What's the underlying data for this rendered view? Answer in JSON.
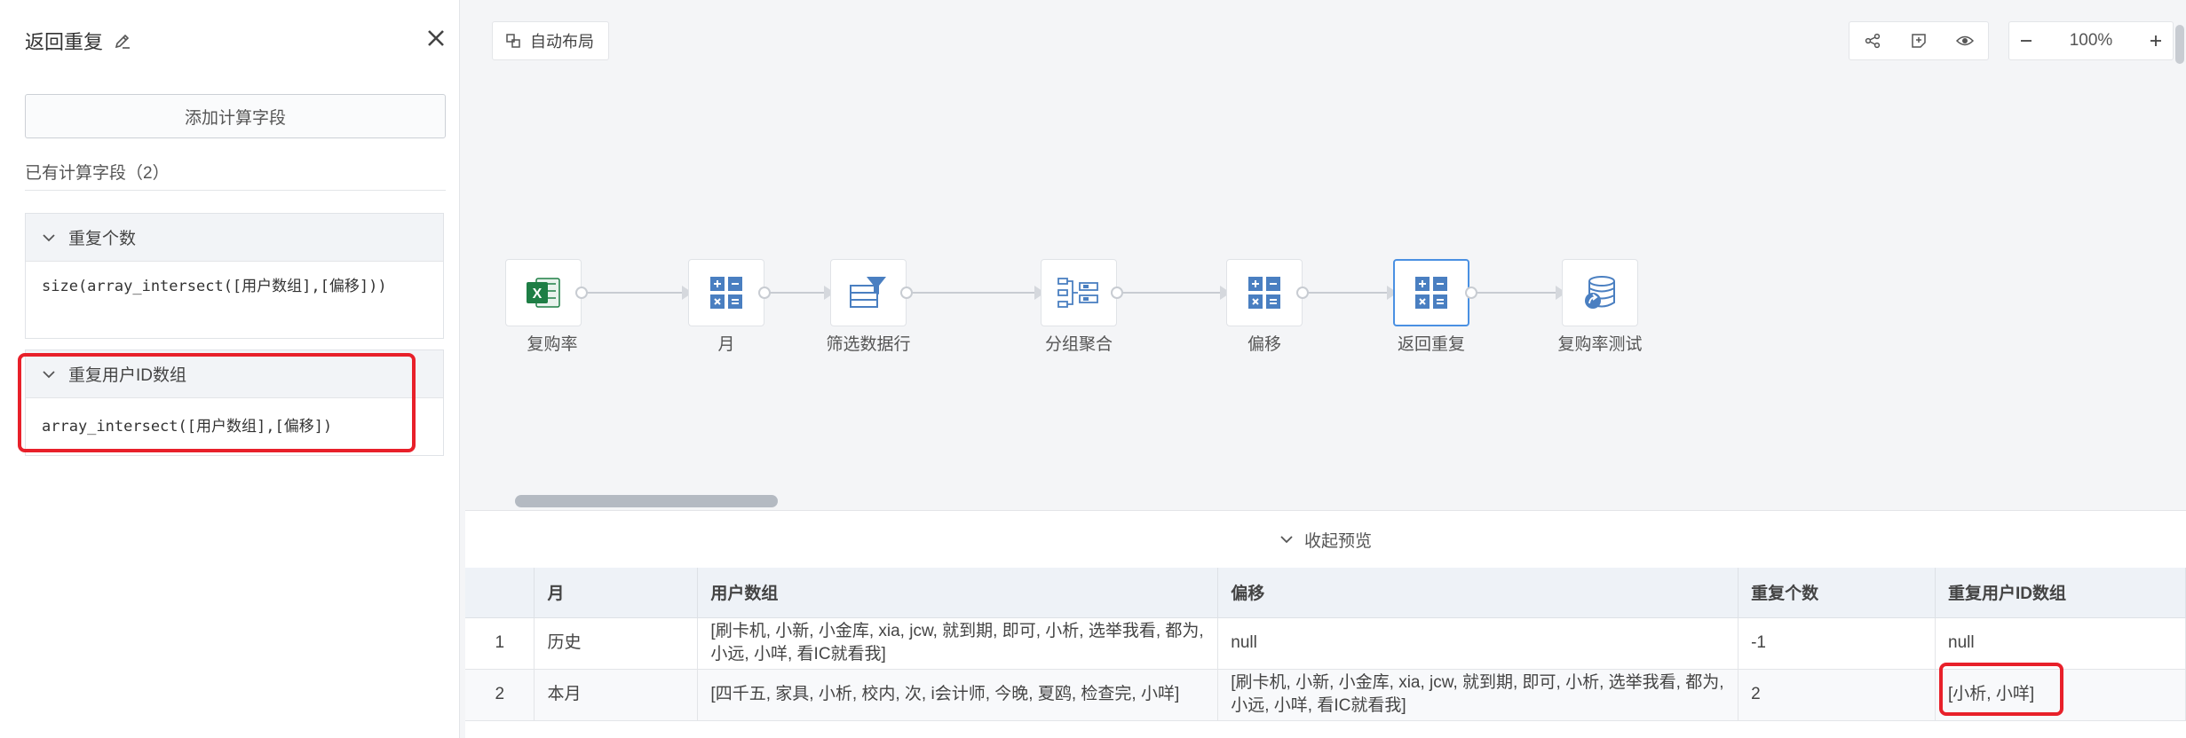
{
  "panel": {
    "title": "返回重复",
    "add_button": "添加计算字段",
    "existing_label": "已有计算字段（2）",
    "fields": [
      {
        "name": "重复个数",
        "expression": "size(array_intersect([用户数组],[偏移]))"
      },
      {
        "name": "重复用户ID数组",
        "expression": "array_intersect([用户数组],[偏移])"
      }
    ]
  },
  "toolbar": {
    "auto_layout": "自动布局",
    "zoom": "100%"
  },
  "flow": {
    "nodes": [
      {
        "label": "复购率",
        "icon": "excel-icon"
      },
      {
        "label": "月",
        "icon": "calculator-icon"
      },
      {
        "label": "筛选数据行",
        "icon": "filter-rows-icon"
      },
      {
        "label": "分组聚合",
        "icon": "group-aggregate-icon"
      },
      {
        "label": "偏移",
        "icon": "calculator-icon"
      },
      {
        "label": "返回重复",
        "icon": "calculator-icon",
        "active": true
      },
      {
        "label": "复购率测试",
        "icon": "database-output-icon"
      }
    ]
  },
  "preview": {
    "collapse_label": "收起预览",
    "columns": [
      "",
      "月",
      "用户数组",
      "偏移",
      "重复个数",
      "重复用户ID数组"
    ],
    "rows": [
      [
        "1",
        "历史",
        "[刷卡机, 小新, 小金库, xia, jcw, 就到期, 即可, 小析, 选举我看, 都为, 小远, 小咩, 看IC就看我]",
        "null",
        "-1",
        "null"
      ],
      [
        "2",
        "本月",
        "[四千五, 家具, 小析, 校内, 次, i会计师, 今晚, 夏鸥, 检查完, 小咩]",
        "[刷卡机, 小新, 小金库, xia, jcw, 就到期, 即可, 小析, 选举我看, 都为, 小远, 小咩, 看IC就看我]",
        "2",
        "[小析, 小咩]"
      ]
    ]
  },
  "colors": {
    "highlight": "#e8202a",
    "accent": "#4a90e2",
    "excel": "#1e7e45",
    "calc": "#4a7fc1"
  }
}
